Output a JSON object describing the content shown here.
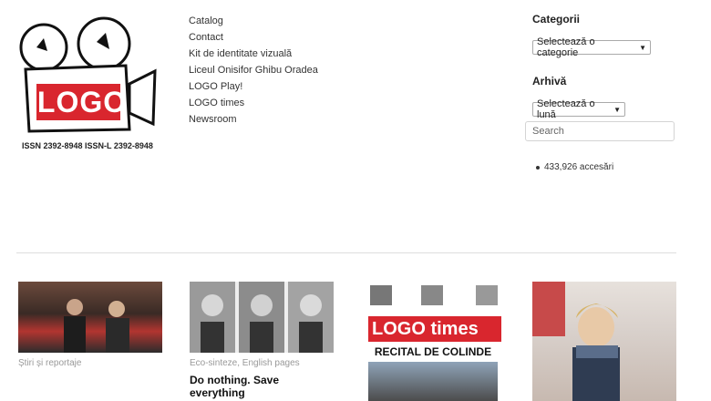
{
  "logo": {
    "wordmark": "LOGO",
    "issn": "ISSN 2392-8948 ISSN-L 2392-8948"
  },
  "menu": [
    {
      "label": "Catalog"
    },
    {
      "label": "Contact"
    },
    {
      "label": "Kit de identitate vizuală"
    },
    {
      "label": "Liceul Onisifor Ghibu Oradea"
    },
    {
      "label": "LOGO Play!"
    },
    {
      "label": "LOGO times"
    },
    {
      "label": "Newsroom"
    }
  ],
  "sidebar": {
    "categories_heading": "Categorii",
    "categories_select": "Selectează o categorie",
    "archive_heading": "Arhivă",
    "archive_select": "Selectează o lună",
    "search_placeholder": "Search",
    "stats": "433,926 accesări"
  },
  "posts": [
    {
      "category": "Știri și reportaje",
      "title": ""
    },
    {
      "category": "Eco-sinteze, English pages",
      "title": "Do nothing. Save everything"
    },
    {
      "category": "",
      "title": "",
      "thumb_title": "LOGO times",
      "thumb_subtitle": "RECITAL DE COLINDE"
    },
    {
      "category": "",
      "title": ""
    }
  ],
  "colors": {
    "brand_red": "#d9262e",
    "text": "#333333",
    "muted": "#999999"
  }
}
